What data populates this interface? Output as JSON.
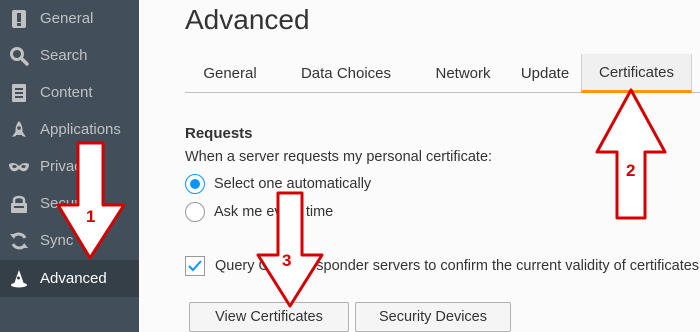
{
  "sidebar": {
    "items": [
      {
        "label": "General",
        "icon": "page-icon"
      },
      {
        "label": "Search",
        "icon": "search-icon"
      },
      {
        "label": "Content",
        "icon": "document-icon"
      },
      {
        "label": "Applications",
        "icon": "rocket-icon"
      },
      {
        "label": "Privacy",
        "icon": "mask-icon"
      },
      {
        "label": "Security",
        "icon": "lock-icon"
      },
      {
        "label": "Sync",
        "icon": "sync-icon"
      },
      {
        "label": "Advanced",
        "icon": "wizard-hat-icon",
        "active": true
      }
    ]
  },
  "main": {
    "title": "Advanced",
    "tabs": [
      "General",
      "Data Choices",
      "Network",
      "Update",
      "Certificates"
    ],
    "active_tab": "Certificates",
    "requests": {
      "title": "Requests",
      "description": "When a server requests my personal certificate:",
      "options": [
        {
          "label": "Select one automatically",
          "checked": true
        },
        {
          "label": "Ask me every time",
          "checked": false
        }
      ]
    },
    "ocsp": {
      "label": "Query OCSP responder servers to confirm the current validity of certificates",
      "checked": true
    },
    "buttons": {
      "view_certificates": "View Certificates",
      "security_devices": "Security Devices"
    }
  },
  "annotations": [
    "1",
    "2",
    "3"
  ],
  "colors": {
    "sidebar_bg": "#424f5a",
    "sidebar_active_bg": "#343f48",
    "accent_orange": "#ff9500",
    "radio_blue": "#0996f8",
    "annotation_red": "#d40000"
  }
}
